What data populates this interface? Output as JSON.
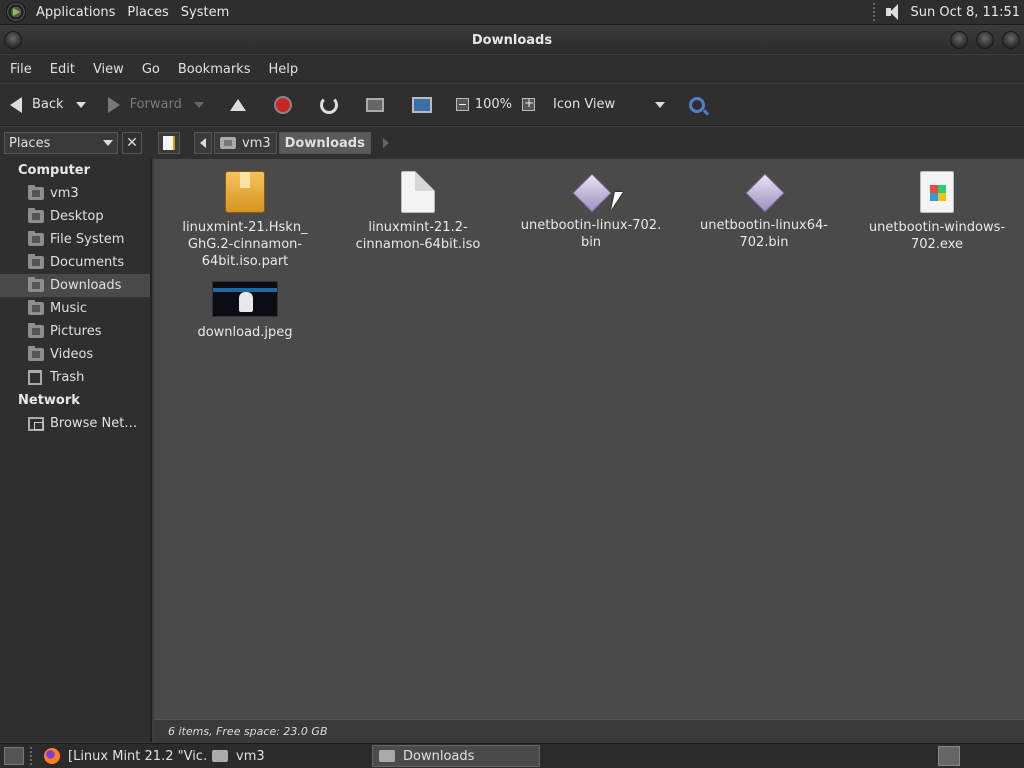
{
  "top_panel": {
    "menu": [
      "Applications",
      "Places",
      "System"
    ],
    "clock": "Sun Oct  8, 11:51"
  },
  "window": {
    "title": "Downloads"
  },
  "menubar": [
    "File",
    "Edit",
    "View",
    "Go",
    "Bookmarks",
    "Help"
  ],
  "toolbar": {
    "back_label": "Back",
    "forward_label": "Forward",
    "zoom": "100%",
    "view_mode": "Icon View"
  },
  "sidebar": {
    "selector": "Places",
    "sections": [
      {
        "heading": "Computer",
        "items": [
          "vm3",
          "Desktop",
          "File System",
          "Documents",
          "Downloads",
          "Music",
          "Pictures",
          "Videos",
          "Trash"
        ]
      },
      {
        "heading": "Network",
        "items": [
          "Browse Net…"
        ]
      }
    ],
    "selected": "Downloads"
  },
  "pathbar": {
    "crumbs": [
      "vm3",
      "Downloads"
    ]
  },
  "files": [
    {
      "name": "linuxmint-21.Hskn_\nGhG.2-cinnamon-\n64bit.iso.part",
      "kind": "package"
    },
    {
      "name": "linuxmint-21.2-\ncinnamon-64bit.iso",
      "kind": "blank"
    },
    {
      "name": "unetbootin-linux-702.\nbin",
      "kind": "binary"
    },
    {
      "name": "unetbootin-linux64-\n702.bin",
      "kind": "binary"
    },
    {
      "name": "unetbootin-windows-\n702.exe",
      "kind": "exe"
    },
    {
      "name": "download.jpeg",
      "kind": "image"
    }
  ],
  "status": "6 items, Free space: 23.0 GB",
  "taskbar": [
    {
      "label": "[Linux Mint 21.2 \"Vic…",
      "icon": "firefox-icon",
      "active": false
    },
    {
      "label": "vm3",
      "icon": "folder-icon",
      "active": false
    },
    {
      "label": "Downloads",
      "icon": "folder-icon",
      "active": true
    }
  ]
}
